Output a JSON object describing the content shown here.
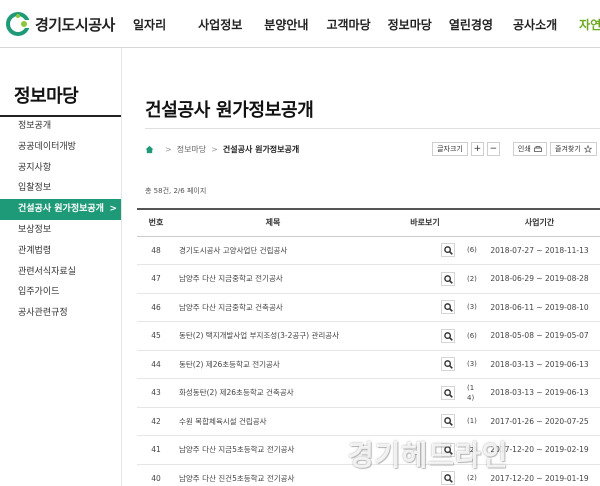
{
  "brand": {
    "name": "경기도시공사",
    "accent": "#1f9a78",
    "nav_accent": "#6aa820"
  },
  "gnb": [
    {
      "label": "일자리"
    },
    {
      "label": "사업정보"
    },
    {
      "label": "분양안내"
    },
    {
      "label": "고객마당"
    },
    {
      "label": "정보마당"
    },
    {
      "label": "열린경영"
    },
    {
      "label": "공사소개"
    },
    {
      "label": "자연&"
    }
  ],
  "sidebar": {
    "title": "정보마당",
    "items": [
      {
        "label": "정보공개"
      },
      {
        "label": "공공데이터개방"
      },
      {
        "label": "공지사항"
      },
      {
        "label": "입찰정보"
      },
      {
        "label": "건설공사 원가정보공개",
        "active": true,
        "chevron": ">"
      },
      {
        "label": "보상정보"
      },
      {
        "label": "관계법령"
      },
      {
        "label": "관련서식자료실"
      },
      {
        "label": "입주가이드"
      },
      {
        "label": "공사관련규정"
      }
    ]
  },
  "page": {
    "title": "건설공사 원가정보공개",
    "breadcrumb": {
      "home_icon": "home-icon",
      "sep": ">",
      "level1": "정보마당",
      "current": "건설공사 원가정보공개"
    },
    "tools": {
      "font_size": "글자크기",
      "plus": "+",
      "minus": "−",
      "print": "인쇄",
      "favorite": "즐겨찾기"
    },
    "count": "총 58건, 2/6 페이지"
  },
  "table": {
    "headers": {
      "num": "번호",
      "subject": "제목",
      "go": "바로보기",
      "period": "사업기간"
    },
    "rows": [
      {
        "num": "48",
        "subject": "경기도시공사 고양사업단 건립공사",
        "count": "(6)",
        "period": "2018-07-27 ~ 2018-11-13"
      },
      {
        "num": "47",
        "subject": "남양주 다산 지금중학교 전기공사",
        "count": "(2)",
        "period": "2018-06-29 ~ 2019-08-28"
      },
      {
        "num": "46",
        "subject": "남양주 다산 지금중학교 건축공사",
        "count": "(3)",
        "period": "2018-06-11 ~ 2019-08-10"
      },
      {
        "num": "45",
        "subject": "동탄(2) 택지개발사업 부지조성(3-2공구) 관리공사",
        "count": "(6)",
        "period": "2018-05-08 ~ 2019-05-07"
      },
      {
        "num": "44",
        "subject": "동탄(2) 제26초등학교 전기공사",
        "count": "(3)",
        "period": "2018-03-13 ~ 2019-06-13"
      },
      {
        "num": "43",
        "subject": "화성동탄(2) 제26초등학교 건축공사",
        "count": "(1\n4)",
        "period": "2018-03-13 ~ 2019-06-13"
      },
      {
        "num": "42",
        "subject": "수원 복합체육시설 건립공사",
        "count": "(1)",
        "period": "2017-01-26 ~ 2020-07-25"
      },
      {
        "num": "41",
        "subject": "남양주 다산 지금5초등학교 전기공사",
        "count": "(2)",
        "period": "2017-12-20 ~ 2019-02-19"
      },
      {
        "num": "40",
        "subject": "남양주 다산 진건5초등학교 전기공사",
        "count": "(2)",
        "period": "2017-12-20 ~ 2019-01-19"
      }
    ]
  },
  "watermark": "경기헤드라인"
}
